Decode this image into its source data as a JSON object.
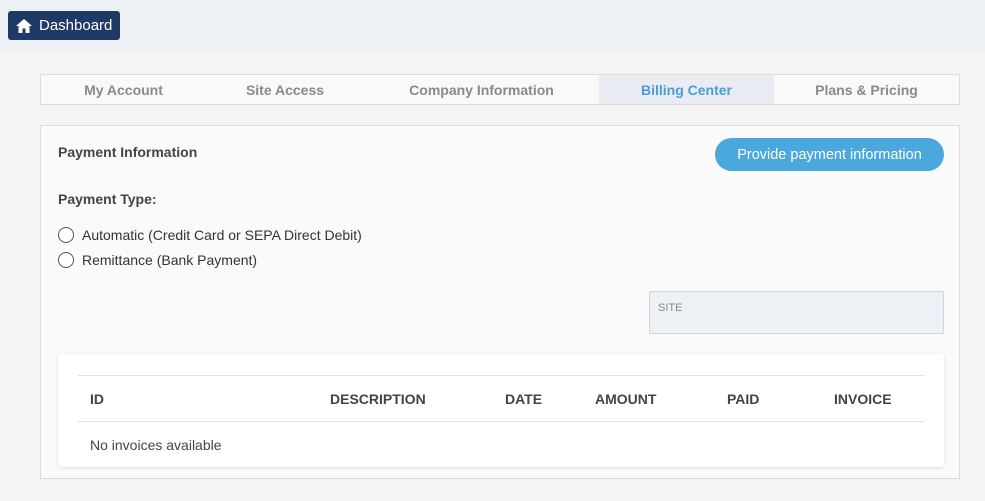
{
  "header": {
    "dashboard_label": "Dashboard"
  },
  "tabs": [
    {
      "label": "My Account",
      "active": false
    },
    {
      "label": "Site Access",
      "active": false
    },
    {
      "label": "Company Information",
      "active": false
    },
    {
      "label": "Billing Center",
      "active": true
    },
    {
      "label": "Plans & Pricing",
      "active": false
    }
  ],
  "billing": {
    "payment_info_title": "Payment Information",
    "provide_button": "Provide payment information",
    "payment_type_label": "Payment Type:",
    "options": [
      "Automatic (Credit Card or SEPA Direct Debit)",
      "Remittance (Bank Payment)"
    ],
    "site_label": "SITE",
    "invoices": {
      "columns": [
        "ID",
        "DESCRIPTION",
        "DATE",
        "AMOUNT",
        "PAID",
        "INVOICE"
      ],
      "empty_text": "No invoices available"
    }
  },
  "colors": {
    "dashboard_bg": "#1f3a66",
    "accent": "#4aa8dc",
    "active_tab_text": "#4a9cd6"
  }
}
